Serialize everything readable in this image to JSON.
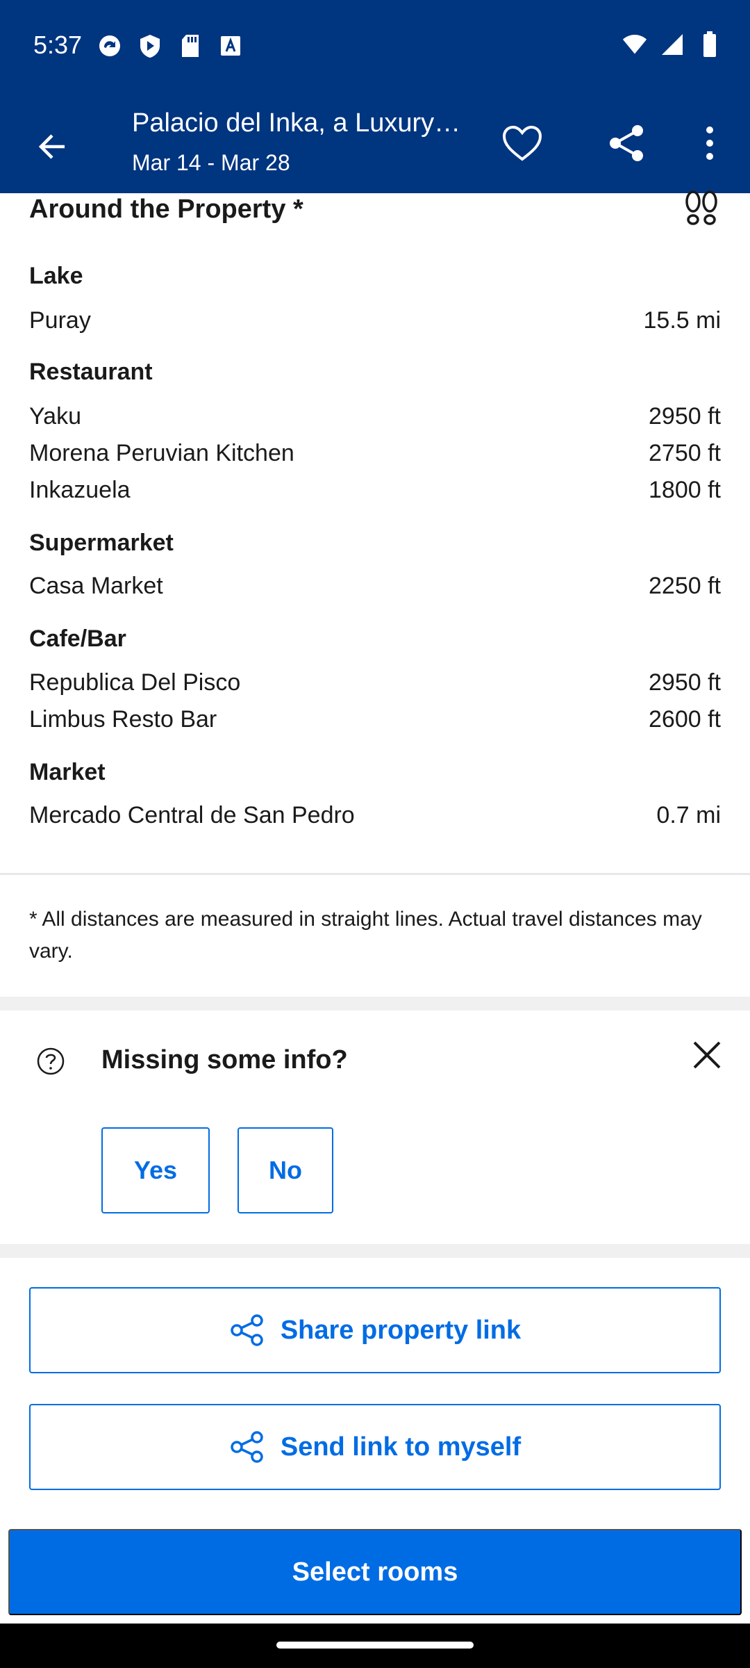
{
  "status_bar": {
    "time": "5:37"
  },
  "app_bar": {
    "title": "Palacio del Inka, a Luxury Collection Hotel",
    "dates": "Mar 14 - Mar 28"
  },
  "around": {
    "header": "Around the Property *",
    "categories": [
      {
        "name": "Lake",
        "items": [
          {
            "place": "Puray",
            "distance": "15.5 mi"
          }
        ]
      },
      {
        "name": "Restaurant",
        "items": [
          {
            "place": "Yaku",
            "distance": "2950 ft"
          },
          {
            "place": "Morena Peruvian Kitchen",
            "distance": "2750 ft"
          },
          {
            "place": "Inkazuela",
            "distance": "1800 ft"
          }
        ]
      },
      {
        "name": "Supermarket",
        "items": [
          {
            "place": "Casa Market",
            "distance": "2250 ft"
          }
        ]
      },
      {
        "name": "Cafe/Bar",
        "items": [
          {
            "place": "Republica Del Pisco",
            "distance": "2950 ft"
          },
          {
            "place": "Limbus Resto Bar",
            "distance": "2600 ft"
          }
        ]
      },
      {
        "name": "Market",
        "items": [
          {
            "place": "Mercado Central de San Pedro",
            "distance": "0.7 mi"
          }
        ]
      }
    ],
    "note": "* All distances are measured in straight lines. Actual travel distances may vary."
  },
  "missing_info": {
    "title": "Missing some info?",
    "yes_label": "Yes",
    "no_label": "No"
  },
  "share": {
    "share_property_label": "Share property link",
    "send_to_self_label": "Send link to myself"
  },
  "cta": {
    "select_rooms_label": "Select rooms"
  },
  "colors": {
    "brand_dark": "#003580",
    "action_blue": "#006ce4"
  }
}
